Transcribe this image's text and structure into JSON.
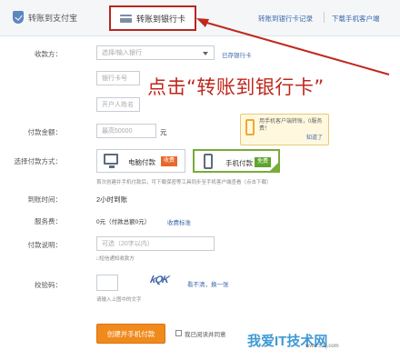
{
  "tabs": {
    "alipay": "转账到支付宝",
    "bank": "转账到银行卡",
    "records": "转账到银行卡记录",
    "client": "下载手机客户端"
  },
  "form": {
    "payee_label": "收款方：",
    "bank_placeholder": "选择/输入银行",
    "saved_cards_link": "已存银行卡",
    "card_placeholder": "银行卡号",
    "name_placeholder": "开户人姓名",
    "amount_label": "付款金额：",
    "amount_placeholder": "最高50000",
    "amount_unit": "元",
    "method_label": "选择付款方式：",
    "pc_option": "电脑付款",
    "pc_badge": "收费",
    "mobile_option": "手机付款",
    "mobile_badge": "免费",
    "method_hint": "首次创建并手机付款后，可下载保密等工具同步至手机客户端查看（点击下载）",
    "arrival_label": "到账时间：",
    "arrival_value": "2小时到账",
    "fee_label": "服务费：",
    "fee_value": "0元（付款总额0元）",
    "fee_link": "收费标准",
    "note_label": "付款说明：",
    "note_placeholder": "可选（20字以内）",
    "sms_text": "□短信通知收款方",
    "captcha_label": "校验码：",
    "captcha_image_text": "kQK",
    "captcha_refresh": "看不清，换一张",
    "captcha_hint": "请输入上图中的文字",
    "submit": "创建并手机付款",
    "agree": "我已阅读并同意"
  },
  "tip": {
    "text": "用手机客户端转账，0服务费！",
    "link": "知道了"
  },
  "annotation": "点击“转账到银行卡”",
  "watermark": {
    "main": "我爱IT技术网",
    "sub": "www.52ij.com"
  },
  "colors": {
    "highlight": "#b6271d",
    "link": "#3a68a8",
    "submit": "#f08a1c",
    "selected": "#7aab3a"
  }
}
